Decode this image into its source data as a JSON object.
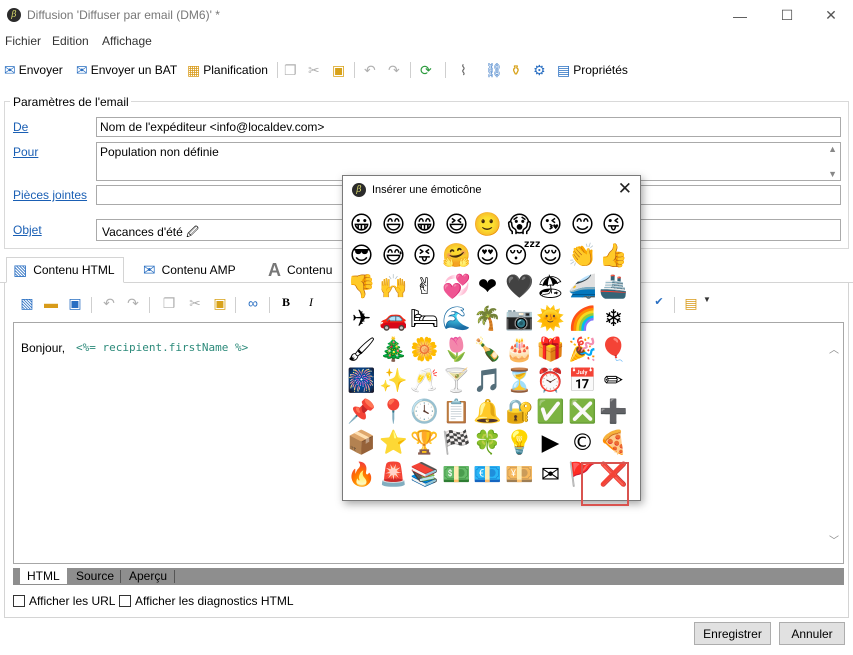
{
  "window": {
    "title": "Diffusion 'Diffuser par email (DM6)' *",
    "minimize_glyph": "—",
    "maximize_glyph": "☐",
    "close_glyph": "✕"
  },
  "menu": [
    "Fichier",
    "Edition",
    "Affichage"
  ],
  "toolbar": {
    "send": "Envoyer",
    "send_bat": "Envoyer un BAT",
    "planning": "Planification",
    "properties": "Propriétés"
  },
  "params": {
    "title": "Paramètres de l'email",
    "from_label": "De",
    "from_value": "Nom de l'expéditeur <info@localdev.com>",
    "to_label": "Pour",
    "to_value": "Population non définie",
    "attachments_label": "Pièces jointes",
    "attachments_value": "",
    "subject_label": "Objet",
    "subject_value": "Vacances d'été 🖉"
  },
  "tabs": {
    "html": "Contenu HTML",
    "amp": "Contenu AMP",
    "text": "Contenu"
  },
  "editor": {
    "greeting": "Bonjour,",
    "code": "<%= recipient.firstName %>",
    "bold": "B",
    "italic": "I"
  },
  "view_tabs": [
    "HTML",
    "Source",
    "Aperçu"
  ],
  "options": {
    "show_urls": "Afficher les URL",
    "show_diagnostics": "Afficher les diagnostics HTML"
  },
  "buttons": {
    "save": "Enregistrer",
    "cancel": "Annuler"
  },
  "emoji_dialog": {
    "title": "Insérer une émoticône",
    "close_glyph": "✕",
    "emojis": [
      "😀",
      "😄",
      "😁",
      "😆",
      "🙂",
      "😱",
      "😘",
      "😊",
      "😜",
      "😎",
      "😅",
      "😝",
      "🤗",
      "😍",
      "😴",
      "😌",
      "👏",
      "👍",
      "👎",
      "🙌",
      "✌",
      "💞",
      "❤",
      "🖤",
      "🏖",
      "🚄",
      "🚢",
      "✈",
      "🚗",
      "🛏",
      "🌊",
      "🌴",
      "📷",
      "🌞",
      "🌈",
      "❄",
      "🖌",
      "🎄",
      "🌼",
      "🌷",
      "🍾",
      "🎂",
      "🎁",
      "🎉",
      "🎈",
      "🎆",
      "✨",
      "🥂",
      "🍸",
      "🎵",
      "⏳",
      "⏰",
      "📅",
      "✏",
      "📌",
      "📍",
      "🕓",
      "📋",
      "🔔",
      "🔐",
      "✅",
      "❎",
      "➕",
      "📦",
      "⭐",
      "🏆",
      "🏁",
      "🍀",
      "💡",
      "▶",
      "©",
      "🍕",
      "🔥",
      "🚨",
      "📚",
      "💵",
      "💶",
      "💴",
      "✉",
      "🚩",
      "❌"
    ]
  }
}
